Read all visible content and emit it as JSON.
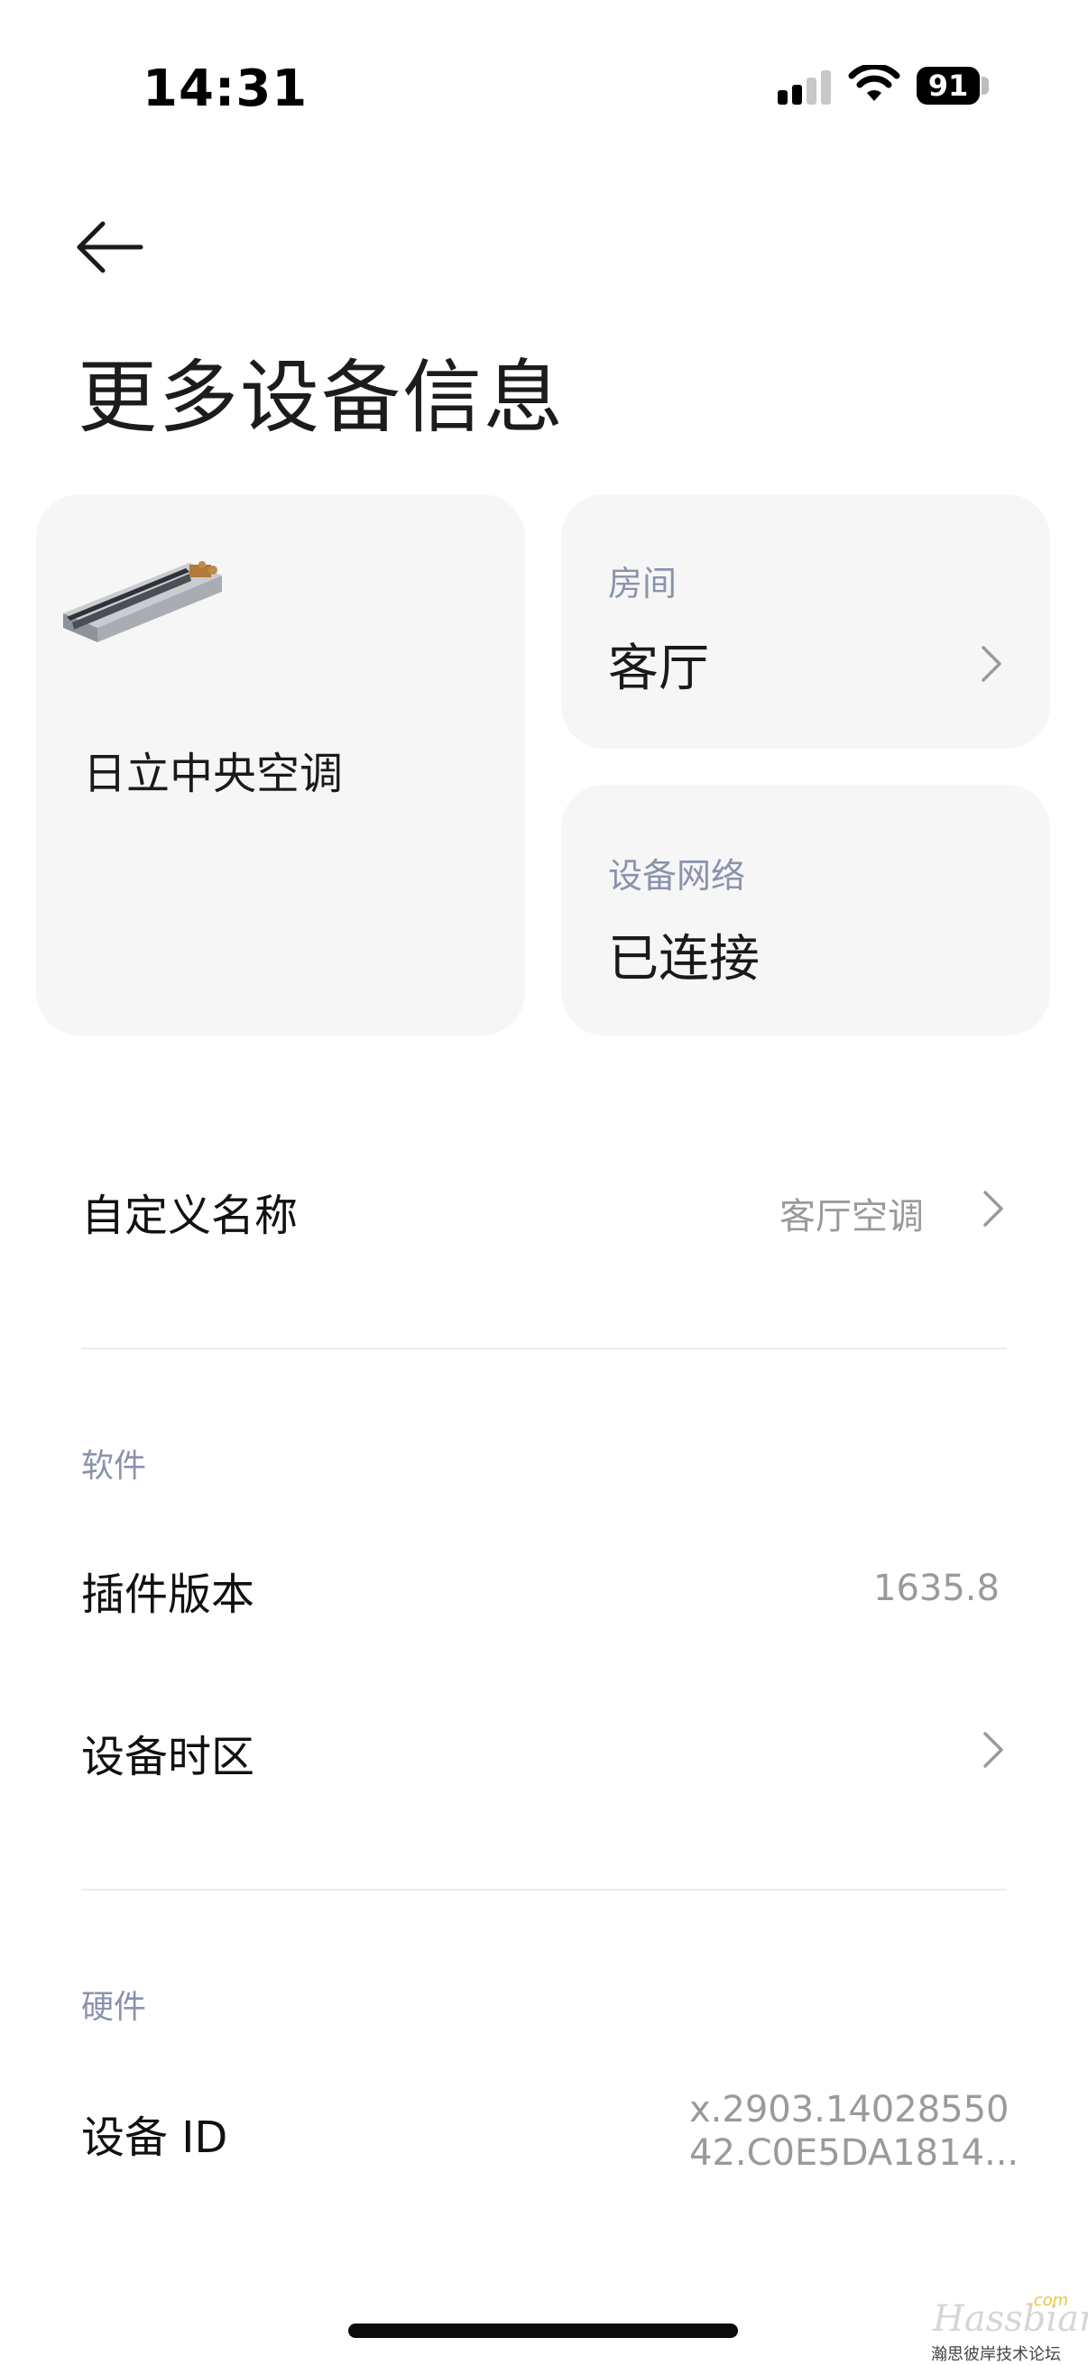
{
  "status_bar": {
    "time": "14:31",
    "battery": "91",
    "signal_icon": "cellular-signal-icon",
    "wifi_icon": "wifi-icon"
  },
  "header": {
    "back_icon": "back-arrow-icon",
    "title": "更多设备信息"
  },
  "cards": {
    "device": {
      "image_icon": "air-conditioner-unit-image",
      "name": "日立中央空调"
    },
    "room": {
      "label": "房间",
      "value": "客厅"
    },
    "network": {
      "label": "设备网络",
      "value": "已连接"
    }
  },
  "custom_name": {
    "label": "自定义名称",
    "value": "客厅空调"
  },
  "software": {
    "section_label": "软件",
    "plugin_version_label": "插件版本",
    "plugin_version_value": "1635.8",
    "timezone_label": "设备时区"
  },
  "hardware": {
    "section_label": "硬件",
    "device_id_label": "设备 ID",
    "device_id_value_line1": "x.2903.14028550",
    "device_id_value_line2": "42.C0E5DA1814..."
  },
  "watermark": {
    "main": "Hassbian",
    "com": ".com",
    "sub": "瀚思彼岸技术论坛"
  },
  "colors": {
    "card_bg": "#f6f6f6",
    "label_muted": "#8a93ad",
    "value_muted": "#9a9a9a",
    "divider": "#ececec"
  }
}
